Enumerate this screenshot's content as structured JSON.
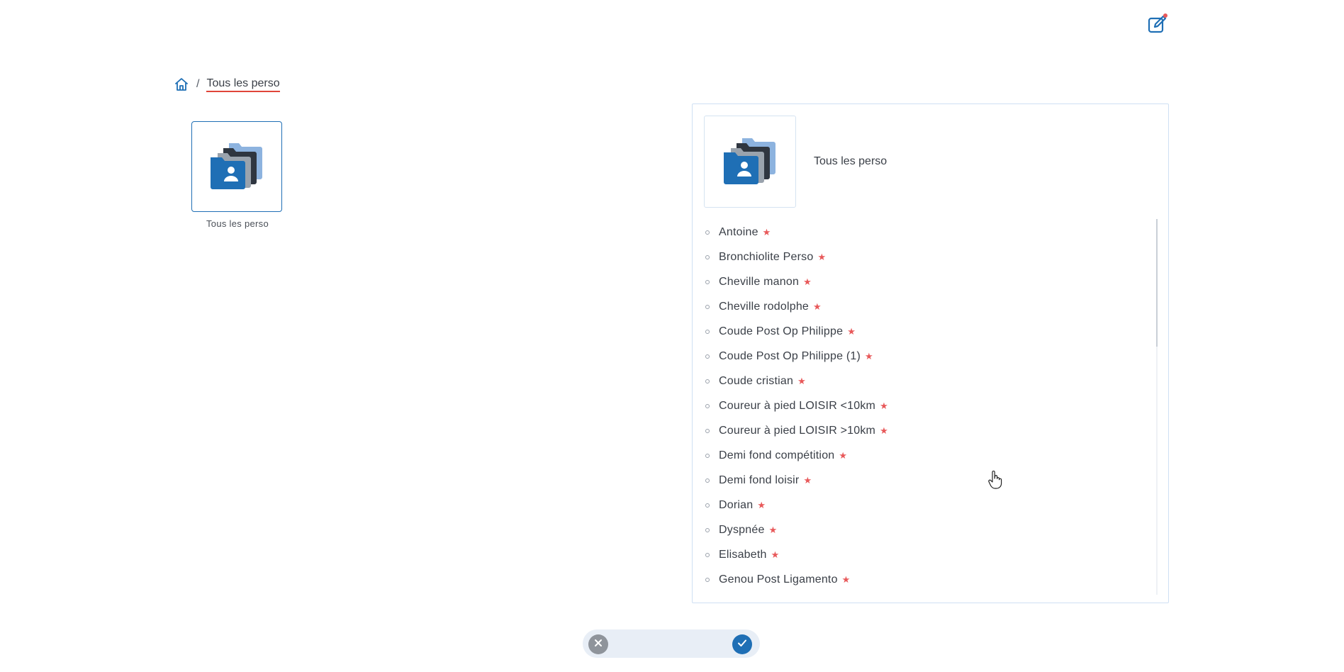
{
  "header": {
    "edit_icon": "edit-icon"
  },
  "breadcrumb": {
    "home_icon": "home-icon",
    "separator": "/",
    "current": "Tous les perso"
  },
  "folder_tile": {
    "icon": "contacts-folder-icon",
    "label": "Tous les perso"
  },
  "panel": {
    "title": "Tous les perso",
    "items": [
      {
        "label": "Antoine"
      },
      {
        "label": "Bronchiolite Perso"
      },
      {
        "label": "Cheville manon"
      },
      {
        "label": "Cheville rodolphe"
      },
      {
        "label": "Coude Post Op Philippe"
      },
      {
        "label": "Coude Post Op Philippe (1)"
      },
      {
        "label": "Coude cristian"
      },
      {
        "label": "Coureur à pied LOISIR <10km"
      },
      {
        "label": "Coureur à pied LOISIR >10km"
      },
      {
        "label": "Demi fond compétition"
      },
      {
        "label": "Demi fond loisir"
      },
      {
        "label": "Dorian"
      },
      {
        "label": "Dyspnée"
      },
      {
        "label": "Elisabeth"
      },
      {
        "label": "Genou Post Ligamento"
      }
    ],
    "item_marker": "★"
  },
  "actions": {
    "cancel_icon": "close-icon",
    "confirm_icon": "check-icon"
  },
  "colors": {
    "accent": "#1f6fb5",
    "star": "#e8595a",
    "action_bar": "#e8eef6",
    "cancel": "#8f949b"
  }
}
